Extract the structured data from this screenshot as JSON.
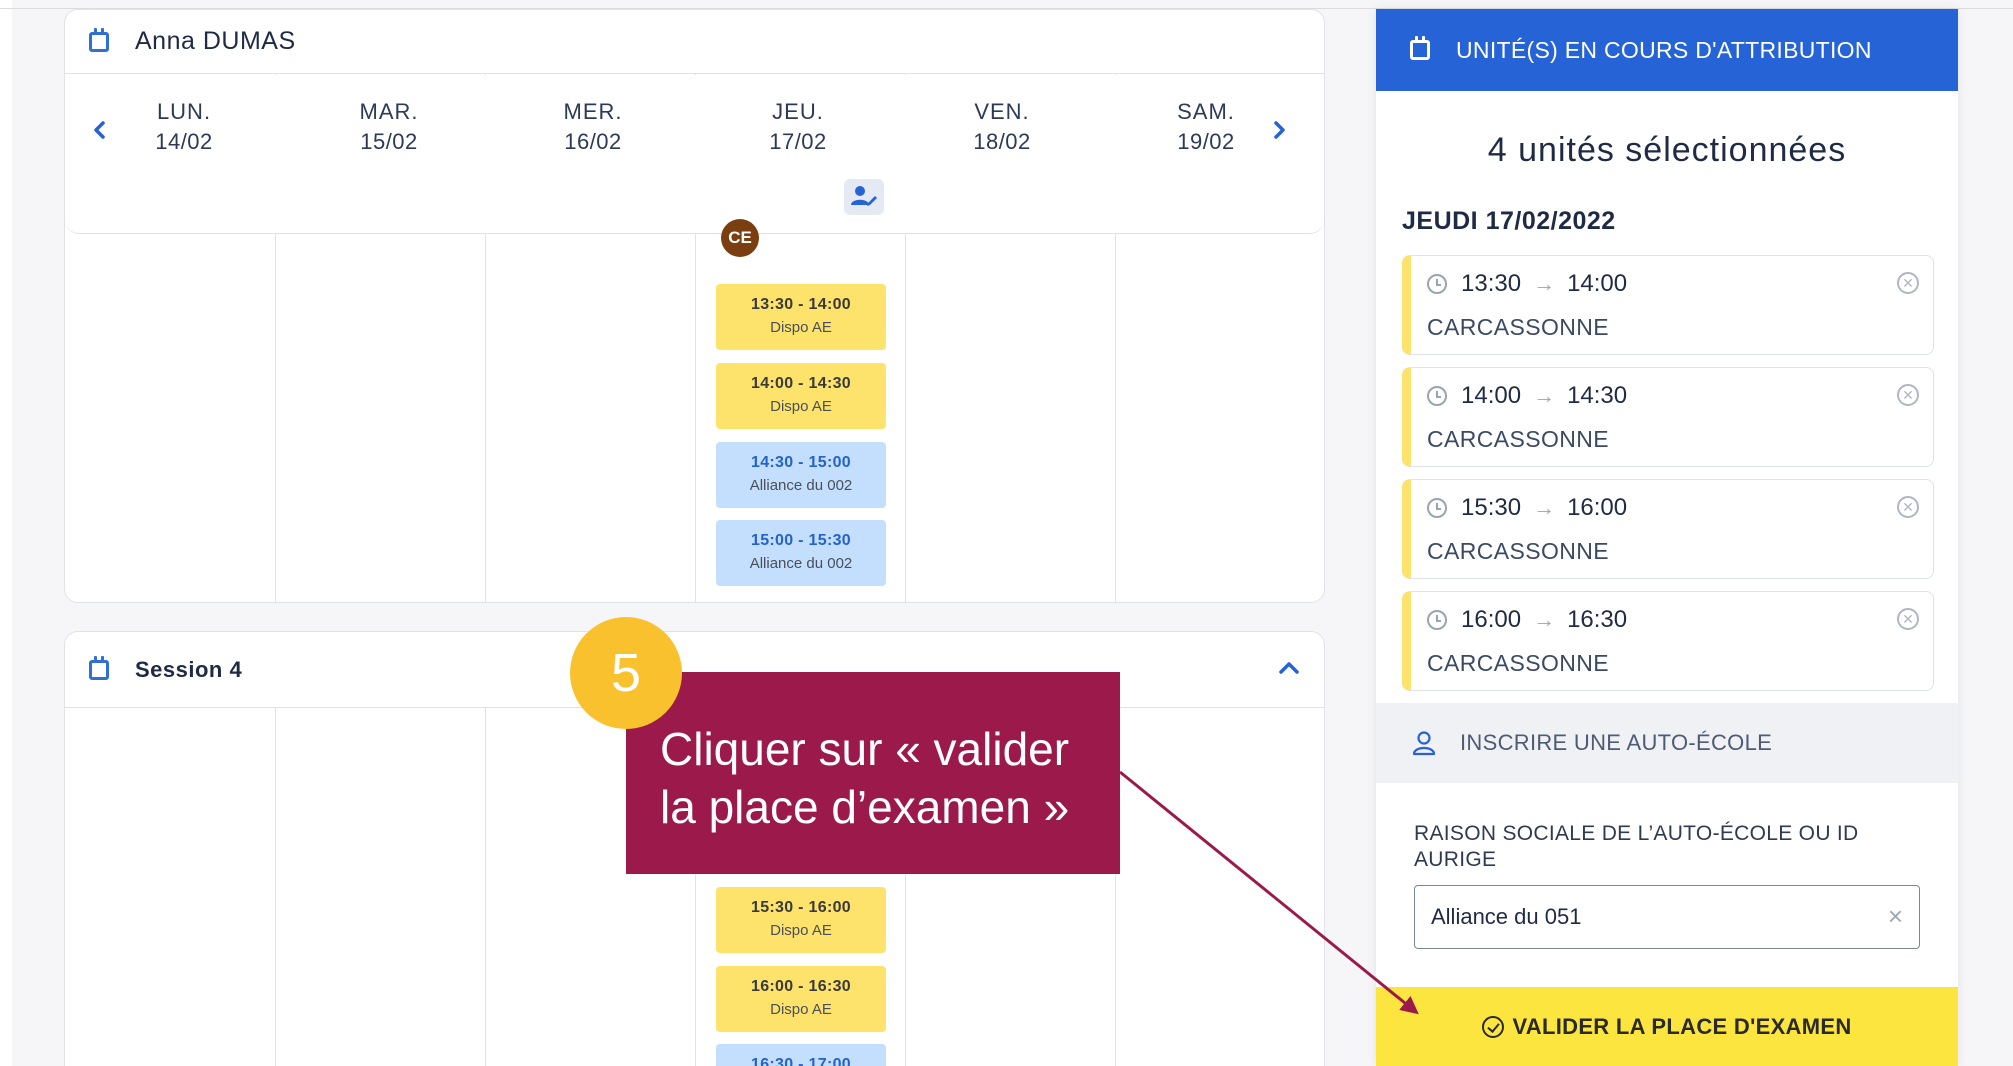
{
  "calendar1": {
    "title": "Anna DUMAS",
    "days": [
      {
        "name": "LUN.",
        "date": "14/02"
      },
      {
        "name": "MAR.",
        "date": "15/02"
      },
      {
        "name": "MER.",
        "date": "16/02"
      },
      {
        "name": "JEU.",
        "date": "17/02"
      },
      {
        "name": "VEN.",
        "date": "18/02"
      },
      {
        "name": "SAM.",
        "date": "19/02"
      }
    ],
    "avatar_initials": "CE",
    "slots": [
      {
        "time": "13:30 - 14:00",
        "label": "Dispo AE",
        "color": "#fde36b"
      },
      {
        "time": "14:00 - 14:30",
        "label": "Dispo AE",
        "color": "#fde36b"
      },
      {
        "time": "14:30 - 15:00",
        "label": "Alliance du 002",
        "color": "#c3dffd"
      },
      {
        "time": "15:00 - 15:30",
        "label": "Alliance du 002",
        "color": "#c3dffd"
      }
    ]
  },
  "calendar2": {
    "title": "Session 4",
    "slots": [
      {
        "time": "15:30 - 16:00",
        "label": "Dispo AE",
        "color": "#fde36b"
      },
      {
        "time": "16:00 - 16:30",
        "label": "Dispo AE",
        "color": "#fde36b"
      },
      {
        "time": "16:30 - 17:00",
        "label": "",
        "color": "#c3dffd"
      }
    ]
  },
  "callout": {
    "step": "5",
    "line1": "Cliquer sur « valider",
    "line2": "la place d’examen »",
    "color": "#9b1a4b"
  },
  "panel": {
    "header": "UNITÉ(S) EN COURS D'ATTRIBUTION",
    "selected_count": "4 unités sélectionnées",
    "date": "JEUDI 17/02/2022",
    "units": [
      {
        "start": "13:30",
        "end": "14:00",
        "location": "CARCASSONNE"
      },
      {
        "start": "14:00",
        "end": "14:30",
        "location": "CARCASSONNE"
      },
      {
        "start": "15:30",
        "end": "16:00",
        "location": "CARCASSONNE"
      },
      {
        "start": "16:00",
        "end": "16:30",
        "location": "CARCASSONNE"
      }
    ],
    "register_label": "INSCRIRE UNE AUTO-ÉCOLE",
    "field_label": "RAISON SOCIALE DE L’AUTO-ÉCOLE OU ID AURIGE",
    "field_value": "Alliance du 051",
    "clear_symbol": "×",
    "validate_label": "VALIDER LA PLACE D'EXAMEN",
    "accent": "#2563d6",
    "validate_color": "#fde540"
  }
}
